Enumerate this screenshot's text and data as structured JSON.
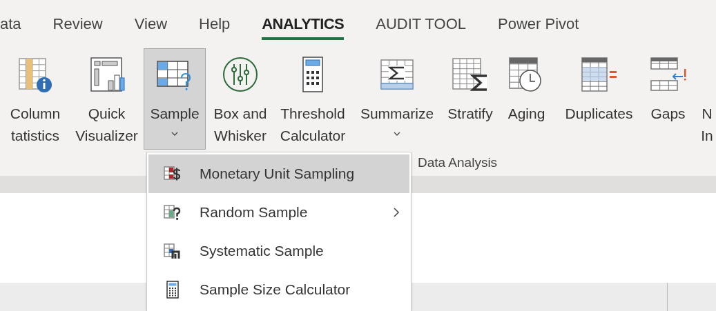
{
  "tabs": [
    {
      "label": "ata",
      "selected": false
    },
    {
      "label": "Review",
      "selected": false
    },
    {
      "label": "View",
      "selected": false
    },
    {
      "label": "Help",
      "selected": false
    },
    {
      "label": "ANALYTICS",
      "selected": true
    },
    {
      "label": "AUDIT TOOL",
      "selected": false
    },
    {
      "label": "Power Pivot",
      "selected": false
    }
  ],
  "ribbon": {
    "buttons": [
      {
        "kind": "column-stats",
        "lines": [
          "Column",
          "tatistics"
        ],
        "dropdown": false,
        "selected": false
      },
      {
        "kind": "visualizer",
        "lines": [
          "Quick",
          "Visualizer"
        ],
        "dropdown": false,
        "selected": false
      },
      {
        "kind": "sample",
        "lines": [
          "Sample"
        ],
        "dropdown": true,
        "selected": true
      },
      {
        "kind": "box-whisker",
        "lines": [
          "Box and",
          "Whisker"
        ],
        "dropdown": false,
        "selected": false
      },
      {
        "kind": "calculator",
        "lines": [
          "Threshold",
          "Calculator"
        ],
        "dropdown": false,
        "selected": false
      },
      {
        "kind": "summarize",
        "lines": [
          "Summarize"
        ],
        "dropdown": true,
        "selected": false
      },
      {
        "kind": "stratify",
        "lines": [
          "Stratify"
        ],
        "dropdown": false,
        "selected": false
      },
      {
        "kind": "aging",
        "lines": [
          "Aging"
        ],
        "dropdown": false,
        "selected": false
      },
      {
        "kind": "duplicates",
        "lines": [
          "Duplicates"
        ],
        "dropdown": false,
        "selected": false
      },
      {
        "kind": "gaps",
        "lines": [
          "Gaps"
        ],
        "dropdown": false,
        "selected": false
      },
      {
        "kind": "partial",
        "lines": [
          "N",
          "In"
        ],
        "dropdown": false,
        "selected": false
      }
    ],
    "group_label": "Data Analysis"
  },
  "menu": {
    "items": [
      {
        "kind": "mus",
        "label": "Monetary Unit Sampling",
        "selected": true,
        "submenu": false
      },
      {
        "kind": "random",
        "label": "Random Sample",
        "selected": false,
        "submenu": true
      },
      {
        "kind": "systematic",
        "label": "Systematic Sample",
        "selected": false,
        "submenu": false
      },
      {
        "kind": "calculator",
        "label": "Sample Size Calculator",
        "selected": false,
        "submenu": false
      }
    ]
  }
}
